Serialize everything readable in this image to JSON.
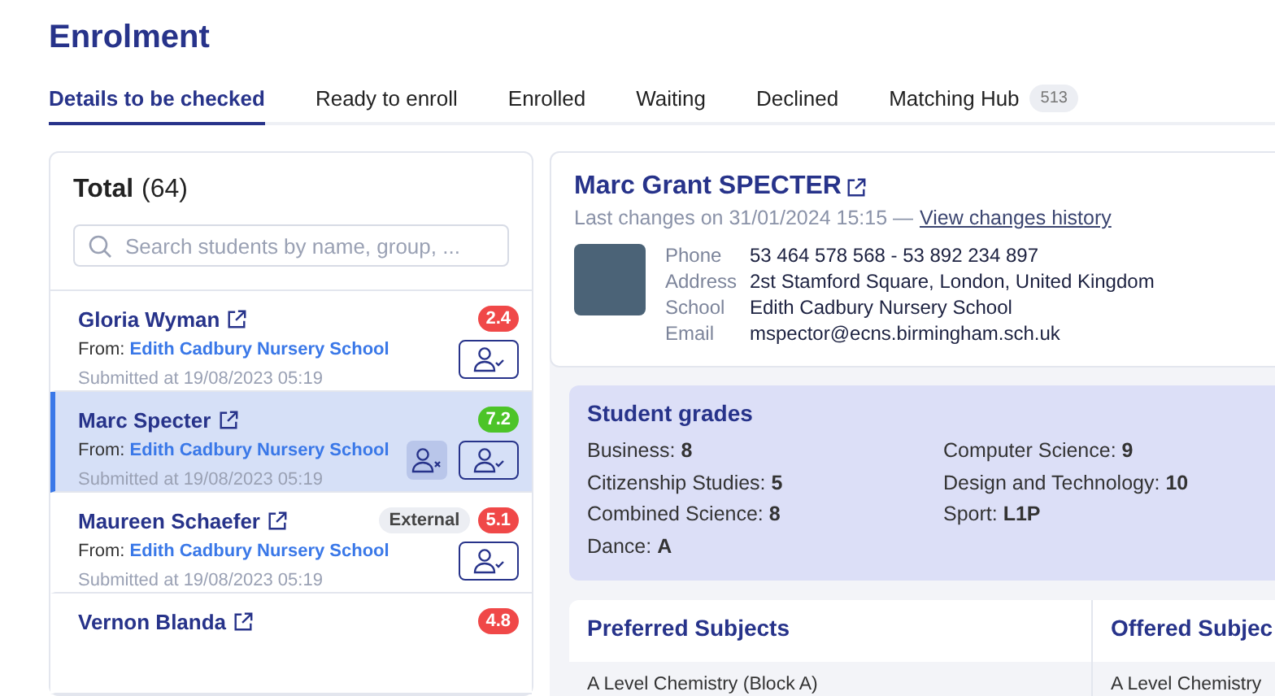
{
  "page": {
    "title": "Enrolment"
  },
  "tabs": [
    {
      "label": "Details to be checked",
      "selected": true
    },
    {
      "label": "Ready to enroll",
      "selected": false
    },
    {
      "label": "Enrolled",
      "selected": false
    },
    {
      "label": "Waiting",
      "selected": false
    },
    {
      "label": "Declined",
      "selected": false
    },
    {
      "label": "Matching Hub",
      "count": "513",
      "selected": false
    }
  ],
  "list": {
    "total_label": "Total",
    "total_count": "(64)",
    "search": {
      "placeholder": "Search students by name, group, ..."
    },
    "students": [
      {
        "name": "Gloria Wyman",
        "from_label": "From:",
        "school": "Edith Cadbury Nursery School",
        "submitted": "Submitted at 19/08/2023 05:19",
        "score": "2.4",
        "color": "#f04848",
        "selected": false
      },
      {
        "name": "Marc Specter",
        "from_label": "From:",
        "school": "Edith Cadbury Nursery School",
        "submitted": "Submitted at 19/08/2023 05:19",
        "score": "7.2",
        "color": "#4cc428",
        "selected": true
      },
      {
        "name": "Maureen Schaefer",
        "tag": "External",
        "from_label": "From:",
        "school": "Edith Cadbury Nursery School",
        "submitted": "Submitted at 19/08/2023 05:19",
        "score": "5.1",
        "color": "#f04848",
        "selected": false
      },
      {
        "name": "Vernon Blanda",
        "score": "4.8",
        "color": "#f04848",
        "selected": false
      }
    ]
  },
  "detail": {
    "name": "Marc Grant SPECTER",
    "last_changes": "Last changes on 31/01/2024 15:15 —",
    "history_link": "View changes history",
    "fields": [
      {
        "label": "Phone",
        "value": "53 464 578 568 - 53 892 234 897"
      },
      {
        "label": "Address",
        "value": "2st Stamford Square, London, United Kingdom"
      },
      {
        "label": "School",
        "value": "Edith Cadbury Nursery School"
      },
      {
        "label": "Email",
        "value": "mspector@ecns.birmingham.sch.uk"
      }
    ]
  },
  "grades": {
    "title": "Student grades",
    "items": [
      {
        "subject": "Business:",
        "grade": "8"
      },
      {
        "subject": "Citizenship Studies:",
        "grade": "5"
      },
      {
        "subject": "Combined Science:",
        "grade": "8"
      },
      {
        "subject": "Dance:",
        "grade": "A"
      },
      {
        "subject": "Computer Science:",
        "grade": "9"
      },
      {
        "subject": "Design and Technology:",
        "grade": "10"
      },
      {
        "subject": "Sport:",
        "grade": "L1P"
      }
    ]
  },
  "subjects": [
    {
      "title": "Preferred Subjects",
      "rows": [
        "A Level Chemistry (Block A)"
      ]
    },
    {
      "title": "Offered Subjec",
      "rows": [
        "A Level Chemistry"
      ]
    }
  ]
}
